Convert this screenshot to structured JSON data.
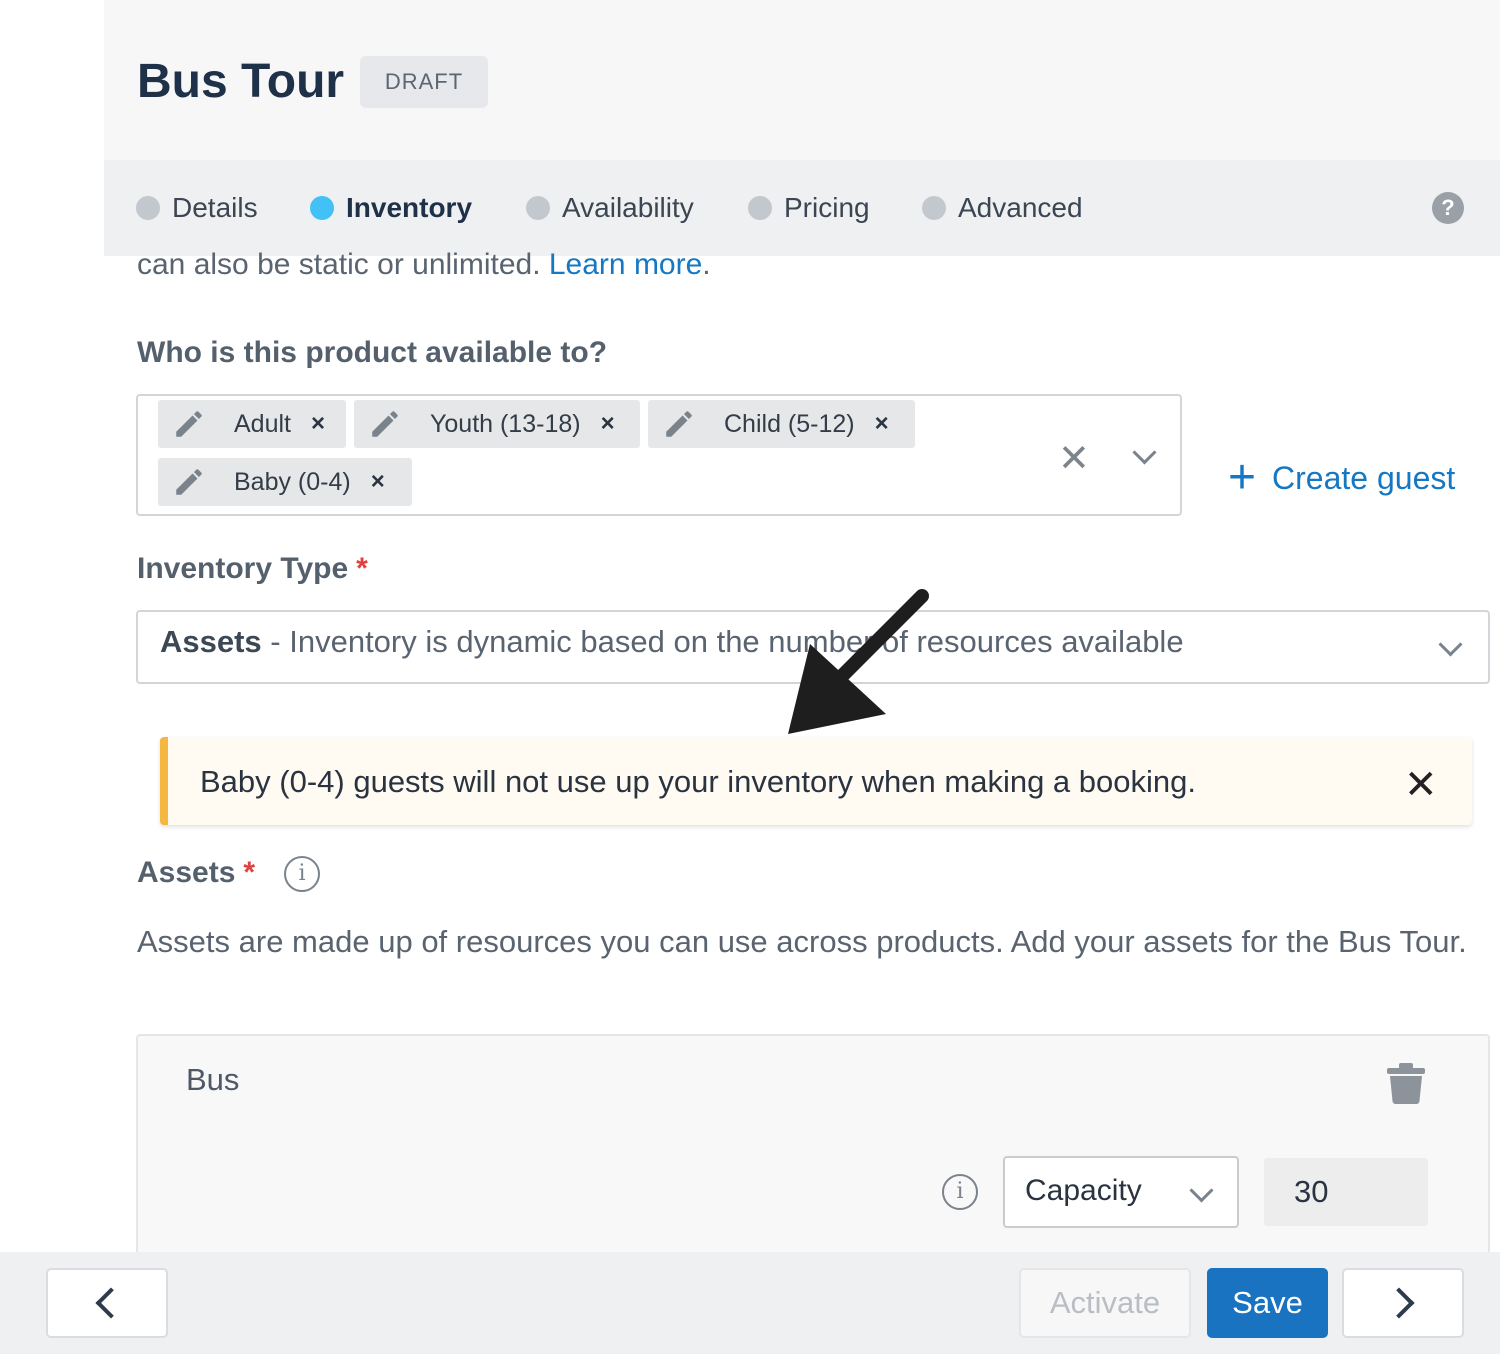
{
  "header": {
    "title": "Bus Tour",
    "status_badge": "DRAFT"
  },
  "tabs": [
    {
      "label": "Details",
      "active": false
    },
    {
      "label": "Inventory",
      "active": true
    },
    {
      "label": "Availability",
      "active": false
    },
    {
      "label": "Pricing",
      "active": false
    },
    {
      "label": "Advanced",
      "active": false
    }
  ],
  "help_icon": "?",
  "intro": {
    "text": "can also be static or unlimited. ",
    "link": "Learn more",
    "suffix": "."
  },
  "guests": {
    "label": "Who is this product available to?",
    "chips": [
      "Adult",
      "Youth (13-18)",
      "Child (5-12)",
      "Baby (0-4)"
    ],
    "remove_glyph": "×",
    "clear_glyph": "✕",
    "create_label": "Create guest"
  },
  "inventory_type": {
    "label": "Inventory Type",
    "required_mark": "*",
    "value_bold": "Assets",
    "value_rest": " - Inventory is dynamic based on the number of resources available"
  },
  "alert": {
    "text": "Baby (0-4) guests will not use up your inventory when making a booking.",
    "close_glyph": "✕"
  },
  "assets": {
    "label": "Assets",
    "required_mark": "*",
    "info_glyph": "i",
    "description": "Assets are made up of resources you can use across products. Add your assets for the Bus Tour.",
    "items": [
      {
        "name": "Bus",
        "metric": "Capacity",
        "value": "30"
      }
    ]
  },
  "footer": {
    "activate_label": "Activate",
    "save_label": "Save"
  },
  "colors": {
    "accent": "#1678c2",
    "active_tab_dot": "#41c1f5",
    "alert_border": "#f4b73f",
    "required": "#e2403c"
  },
  "icons": [
    "pencil-icon",
    "close-icon",
    "chevron-down-icon",
    "plus-icon",
    "info-icon",
    "trash-icon",
    "chevron-left-icon",
    "chevron-right-icon",
    "help-icon",
    "annotation-arrow"
  ]
}
